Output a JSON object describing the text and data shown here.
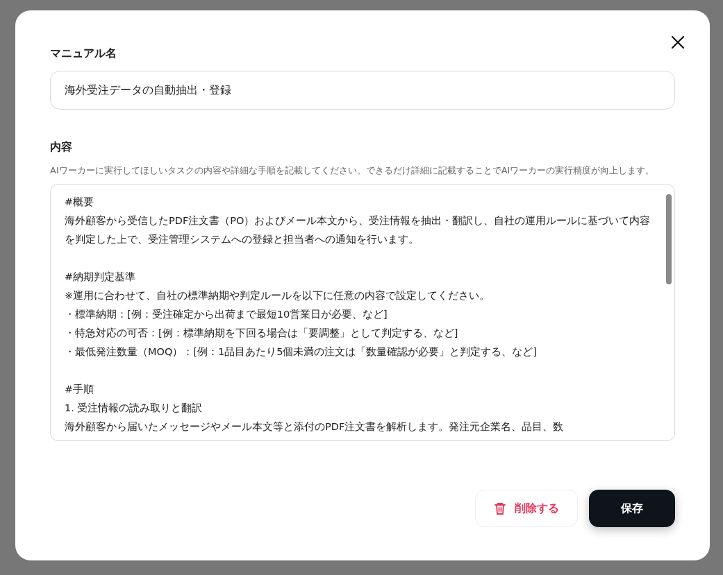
{
  "dialog": {
    "name_label": "マニュアル名",
    "name_value": "海外受注データの自動抽出・登録",
    "content_label": "内容",
    "content_help": "AIワーカーに実行してほしいタスクの内容や詳細な手順を記載してください。できるだけ詳細に記載することでAIワーカーの実行精度が向上します。",
    "content_paragraphs": [
      {
        "lines": [
          "#概要",
          "海外顧客から受信したPDF注文書（PO）およびメール本文から、受注情報を抽出・翻訳し、自社の運用ルールに基づいて内容を判定した上で、受注管理システムへの登録と担当者への通知を行います。"
        ]
      },
      {
        "lines": [
          "#納期判定基準",
          "※運用に合わせて、自社の標準納期や判定ルールを以下に任意の内容で設定してください。",
          "・標準納期：[例：受注確定から出荷まで最短10営業日が必要、など]",
          "・特急対応の可否：[例：標準納期を下回る場合は「要調整」として判定する、など]",
          "・最低発注数量（MOQ）：[例：1品目あたり5個未満の注文は「数量確認が必要」と判定する、など]"
        ]
      },
      {
        "lines": [
          "#手順",
          "1. 受注情報の読み取りと翻訳",
          "海外顧客から届いたメッセージやメール本文等と添付のPDF注文書を解析します。発注元企業名、品目、数"
        ]
      }
    ],
    "buttons": [
      {
        "kind": "delete",
        "label": "削除する"
      },
      {
        "kind": "save",
        "label": "保存"
      }
    ]
  }
}
